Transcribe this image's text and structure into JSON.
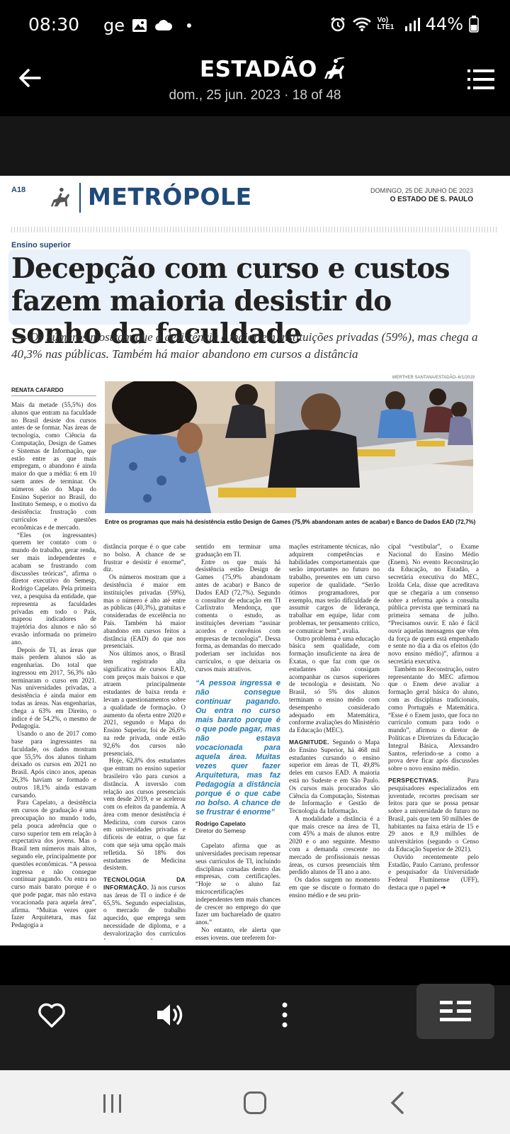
{
  "status_bar": {
    "time": "08:30",
    "carrier_text": "ge",
    "network": "Vo) LTE1",
    "battery": "44%"
  },
  "app_header": {
    "brand": "ESTADÃO",
    "subtitle": "dom., 25 jun. 2023 · 18 of 48"
  },
  "newspaper": {
    "page_number": "A18",
    "section": "METRÓPOLE",
    "date": "DOMINGO, 25 DE JUNHO DE 2023",
    "paper_name": "O ESTADO DE S. PAULO",
    "kicker": "Ensino superior",
    "headline": "Decepção com curso e custos fazem maioria desistir do sonho da faculdade",
    "deck": "Os números mostram que a desistência é maior em instituições privadas (59%), mas chega a 40,3% nas públicas. Também há maior abandono em cursos a distância",
    "byline": "RENATA CAFARDO",
    "photo_credit": "WERTHER SANTANA/ESTADÃO–6/1/2019",
    "caption": "Entre os programas que mais há desistência estão Design de Games (75,9% abandonam antes de acabar) e Banco de Dados EAD (72,7%)",
    "col1": [
      "Mais da metade (55,5%) dos alunos que entram na faculdade no Brasil desiste dos cursos antes de se formar. Nas áreas de tecnologia, como Ciência da Computação, Design de Games e Sistemas de Informação, que estão entre as que mais empregam, o abandono é ainda maior do que a média: 6 em 10 saem antes de terminar. Os números são do Mapa do Ensino Superior no Brasil, do Instituto Semesp, e o motivo da desistência: frustração com currículos e questões econômicas e de mercado.",
      "“Eles (os ingressantes) querem ter contato com o mundo do trabalho, gerar renda, ser mais independentes e acabam se frustrando com discussões teóricas”, afirma o diretor executivo do Semesp, Rodrigo Capelato. Pela primeira vez, a pesquisa da entidade, que representa as faculdades privadas em todo o País, mapeou indicadores de trajetória dos alunos e não só evasão informada no primeiro ano.",
      "Depois de TI, as áreas que mais perdem alunos são as engenharias. Do total que ingressou em 2017, 56,3% não terminaram o curso em 2021. Nas universidades privadas, a desistência é ainda maior em todas as áreas. Nas engenharias, chega a 63% em Direito, o índice é de 54,2%, o mesmo de Pedagogia.",
      "Usando o ano de 2017 como base para ingressantes na faculdade, os dados mostram que 55,5% dos alunos tinham deixado os cursos em 2021 no Brasil. Após cinco anos, apenas 26,3% haviam se formado e outros 18,1% ainda estavam cursando.",
      "Para Capelato, a desistência em cursos de graduação é uma preocupação no mundo todo, pela pouca aderência que o curso superior tem em relação à expectativa dos jovens. Mas o Brasil tem números mais altos, segundo ele, principalmente por questões econômicas. “A pessoa ingressa e não consegue continuar pagando. Ou entra no curso mais barato porque é o que pode pagar, mas não estava vocacionada para aquela área”, afirma. “Muitas vezes quer fazer Arquitetura, mas faz Pedagogia a"
    ],
    "col2": [
      "distância porque é o que cabe no bolso. A chance de se frustrar e desistir é enorme”, diz.",
      "Os números mostram que a desistência é maior em instituições privadas (59%), mas o número é alto até entre as públicas (40,3%), gratuitas e consideradas de excelência no País. Também há maior abandono em cursos feitos a distância (EAD) do que nos presenciais.",
      "Nos últimos anos, o Brasil tem registrado alta significativa de cursos EAD, com preços mais baixos e que atraem principalmente estudantes de baixa renda e levam a questionamentos sobre a qualidade de formação. O aumento da oferta entre 2020 e 2021, segundo o Mapa do Ensino Superior, foi de 26,6% na rede privada, onde estão 92,6% dos cursos não presenciais.",
      "Hoje, 62,8% dos estudantes que entram no ensino superior brasileiro vão para cursos a distância. A inversão com relação aos cursos presenciais vem desde 2019, e se acelerou com os efeitos da pandemia. A área com menor desistência é Medicina, com cursos caros em universidades privadas e difíceis de entrar, o que faz com que seja uma opção mais refletida. Só 18% dos estudantes de Medicina desistem."
    ],
    "col2_subhead": "TECNOLOGIA DA INFORMAÇÃO.",
    "col2_sub_text": "Já nos cursos nas áreas de TI o índice é de 65,5%. Segundo especialistas, o mercado de trabalho aquecido, que emprega sem necessidade de diploma, e a desvalorização dos currículos fazem os jovens não verem",
    "col3": [
      "sentido em terminar uma graduação em TI.",
      "Entre os que mais há desistência estão Design de Games (75,9% abandonam antes de acabar) e Banco de Dados EAD (72,7%). Segundo o consultor de educação em TI Carlixtrato Mendonça, que comenta o estudo, as instituições deveriam “assinar acordos e convênios com empresas de tecnologia”. Dessa forma, as demandas do mercado poderiam ser incluídas nos currículos, o que deixaria os cursos mais atrativos."
    ],
    "pull_quote": "“A pessoa ingressa e não consegue continuar pagando. Ou entra no curso mais barato porque é o que pode pagar, mas não estava vocacionada para aquela área. Muitas vezes quer fazer Arquitetura, mas faz Pedagogia a distância porque é o que cabe no bolso. A chance de se frustrar é enorme”",
    "pull_name": "Rodrigo Capelato",
    "pull_role": "Diretor do Semesp",
    "col3_after": [
      "Capelato afirma que as universidades precisam repensar seus currículos de TI, incluindo disciplinas cursadas dentro das empresas, com certificações. “Hoje se o aluno faz microcertificações independentes tem mais chances de crescer no emprego do que fazer um bacharelado de quatro anos.”",
      "No entanto, ele alerta que esses jovens, que preferem for-"
    ],
    "col4": [
      "mações estritamente técnicas, não adquirem competências e habilidades comportamentais que serão importantes no futuro no trabalho, presentes em um curso superior de qualidade. “Serão ótimos programadores, por exemplo, mas terão dificuldade de assumir cargos de liderança, trabalhar em equipe, lidar com problemas, ter pensamento crítico, se comunicar bem”, avalia.",
      "Outro problema é uma educação básica sem qualidade, com formação insuficiente na área de Exatas, o que faz com que os estudantes não consigam acompanhar os cursos superiores de tecnologia e desistam. No Brasil, só 5% dos alunos terminam o ensino médio com desempenho considerado adequado em Matemática, conforme avaliações do Ministério da Educação (MEC)."
    ],
    "col4_subhead": "MAGNITUDE.",
    "col4_sub_text": "Segundo o Mapa do Ensino Superior, há 468 mil estudantes cursando o ensino superior em áreas de TI, 49,8% deles em cursos EAD. A maioria está no Sudeste e em São Paulo. Os cursos mais procurados são Ciência da Computação, Sistemas de Informação e Gestão de Tecnologia da Informação.",
    "col4_after": [
      "A modalidade a distância é a que mais cresce na área de TI, com 45% a mais de alunos entre 2020 e o ano seguinte. Mesmo com a demanda crescente no mercado de profissionais nessas áreas, os cursos presenciais têm perdido alunos de TI ano a ano.",
      "Os dados surgem no momento em que se discute o formato do ensino médio e de seu prin-"
    ],
    "col5": [
      "cipal “vestibular”, o Exame Nacional do Ensino Médio (Enem). No evento Reconstrução da Educação, no Estadão, a secretária executiva do MEC, Izolda Cela, disse que acreditava que se chegaria a um consenso sobre a reforma após a consulta pública prevista que terminará na primeira semana de julho. “Precisamos ouvir. E não é fácil ouvir aquelas mensagens que vêm da força de quem está empenhado e sente no dia a dia os efeitos (do novo ensino médio)”, afirmou a secretária executiva.",
      "Também no Reconstrução, outro representante do MEC afirmou que o Enem deve avaliar a formação geral básica do aluno, com as disciplinas tradicionais, como Português e Matemática. “Esse é o Enem justo, que foca no currículo comum para todo o mundo”, afirmou o diretor de Políticas e Diretrizes da Educação Integral Básica, Alexsandro Santos, referindo-se a como a prova deve ficar após discussões sobre o novo ensino médio."
    ],
    "col5_subhead": "PERSPECTIVAS.",
    "col5_sub_text": "Para pesquisadores especializados em juventude, recortes precisam ser feitos para que se possa pensar sobre a universidade do futuro no Brasil, país que tem 50 milhões de habitantes na faixa etária de 15 e 29 anos e 8,9 milhões de universitários (segundo o Censo da Educação Superior de 2021).",
    "col5_after": [
      "Ouvido recentemente pelo Estadão, Paulo Carrano, professor e pesquisador da Universidade Federal Fluminense (UFF), destaca que o papel ➔"
    ]
  },
  "colors": {
    "section_blue": "#1f4a7a",
    "pull_quote_blue": "#1f7cb5",
    "headline_highlight": "#e9f1fb"
  },
  "icons": [
    "back-arrow-icon",
    "menu-icon",
    "heart-icon",
    "speaker-icon",
    "more-vertical-icon",
    "page-view-icon",
    "horse-rider-logo-icon"
  ]
}
